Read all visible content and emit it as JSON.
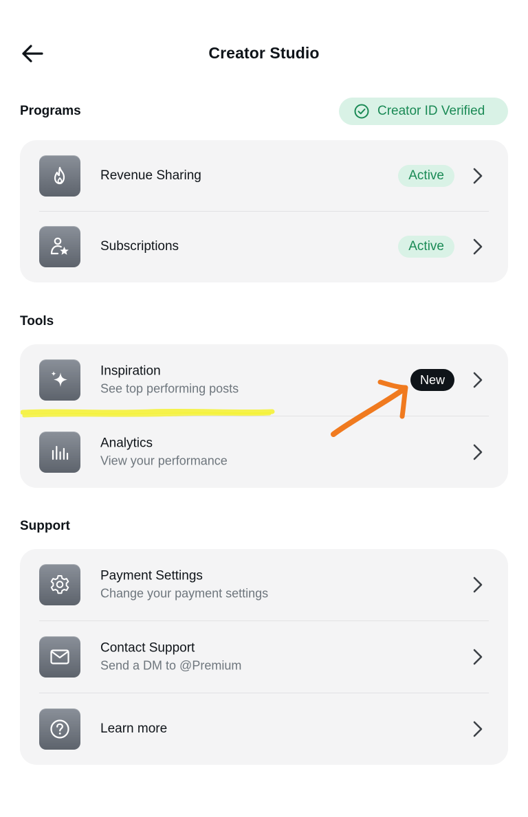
{
  "header": {
    "title": "Creator Studio"
  },
  "badges": {
    "creator_id": "Creator ID Verified"
  },
  "sections": {
    "programs": {
      "title": "Programs",
      "items": [
        {
          "title": "Revenue Sharing",
          "status": "Active",
          "icon": "flame-icon"
        },
        {
          "title": "Subscriptions",
          "status": "Active",
          "icon": "person-star-icon"
        }
      ]
    },
    "tools": {
      "title": "Tools",
      "items": [
        {
          "title": "Inspiration",
          "subtitle": "See top performing posts",
          "tag": "New",
          "icon": "sparkle-icon"
        },
        {
          "title": "Analytics",
          "subtitle": "View your performance",
          "icon": "bar-chart-icon"
        }
      ]
    },
    "support": {
      "title": "Support",
      "items": [
        {
          "title": "Payment Settings",
          "subtitle": "Change your payment settings",
          "icon": "gear-icon"
        },
        {
          "title": "Contact Support",
          "subtitle": "Send a DM to @Premium",
          "icon": "envelope-icon"
        },
        {
          "title": "Learn more",
          "icon": "question-icon"
        }
      ]
    }
  },
  "colors": {
    "accent_green": "#1a8a55",
    "badge_green_bg": "#d9f2e6",
    "card_bg": "#f4f4f5",
    "annotation_highlight": "#f5f23a",
    "annotation_arrow": "#f07a1f"
  }
}
